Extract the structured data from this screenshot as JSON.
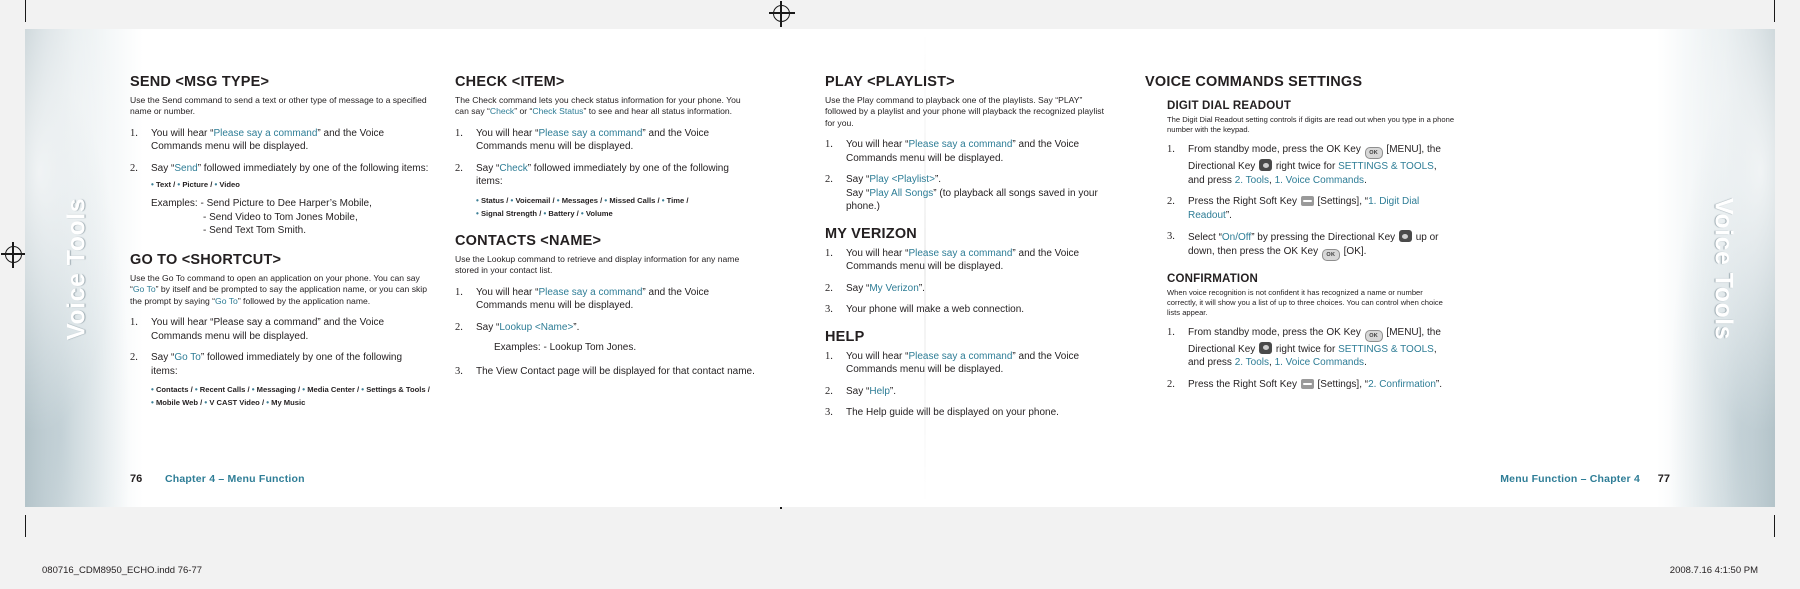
{
  "spread": {
    "left_page_number": "76",
    "right_page_number": "77",
    "left_running_head": "Chapter 4 – Menu Function",
    "right_running_head": "Menu Function – Chapter 4",
    "side_tab_label": "Voice Tools",
    "file_meta_left": "080716_CDM8950_ECHO.indd   76-77",
    "file_meta_right": "2008.7.16   4:1:50 PM"
  },
  "col1": {
    "s1": {
      "heading": "SEND <MSG TYPE>",
      "intro": "Use the Send command to send a text or other type of message to a specified name or number.",
      "step1_a": "You will hear “",
      "step1_hl": "Please say a command",
      "step1_b": "” and the Voice Commands menu will be displayed.",
      "step2_a": "Say “",
      "step2_hl": "Send",
      "step2_b": "” followed immediately by one of the following items:",
      "bullets": [
        "Text",
        "Picture",
        "Video"
      ],
      "examples_label": "Examples:",
      "examples": [
        "- Send Picture to Dee Harper’s Mobile,",
        "- Send Video to Tom Jones Mobile,",
        "- Send Text Tom Smith."
      ]
    },
    "s2": {
      "heading": "GO TO <SHORTCUT>",
      "intro_a": "Use the Go To command to open an application on your phone. You can say “",
      "intro_hl1": "Go To",
      "intro_b": "” by itself and be prompted to say the application name, or you can skip the prompt by saying “",
      "intro_hl2": "Go To",
      "intro_c": "” followed by the application name.",
      "step1": "You will hear “Please say a command” and the Voice Commands menu will be displayed.",
      "step2_a": "Say “",
      "step2_hl": "Go To",
      "step2_b": "” followed immediately by one of the following items:",
      "bullets_row1": [
        "Contacts",
        "Recent Calls",
        "Messaging",
        "Media Center",
        "Settings & Tools"
      ],
      "bullets_row2": [
        "Mobile Web",
        "V CAST Video",
        "My Music"
      ]
    }
  },
  "col2": {
    "s1": {
      "heading": "CHECK <ITEM>",
      "intro_a": "The Check command lets you check status information for your phone. You can say “",
      "intro_hl1": "Check",
      "intro_b": "” or “",
      "intro_hl2": "Check Status",
      "intro_c": "” to see and hear all status information.",
      "step1_a": "You will hear “",
      "step1_hl": "Please say a command",
      "step1_b": "” and the Voice Commands menu will be displayed.",
      "step2_a": "Say “",
      "step2_hl": "Check",
      "step2_b": "” followed immediately by one of the following items:",
      "bullets_row1": [
        "Status",
        "Voicemail",
        "Messages",
        "Missed Calls",
        "Time"
      ],
      "bullets_row2": [
        "Signal Strength",
        "Battery",
        "Volume"
      ]
    },
    "s2": {
      "heading": "CONTACTS <NAME>",
      "intro": "Use the Lookup command to retrieve and display information for any name stored in your contact list.",
      "step1_a": "You will hear “",
      "step1_hl": "Please say a command",
      "step1_b": "” and the Voice Commands menu will be displayed.",
      "step2_a": "Say “",
      "step2_hl": "Lookup <Name>",
      "step2_b": "”.",
      "example": "Examples: - Lookup Tom Jones.",
      "step3": "The View Contact page will be displayed for that contact name."
    }
  },
  "col3": {
    "s1": {
      "heading": "PLAY <PLAYLIST>",
      "intro": "Use the Play command to playback one of the playlists. Say “PLAY” followed by a playlist and your phone will playback the recognized playlist for you.",
      "step1_a": "You will hear “",
      "step1_hl": "Please say a command",
      "step1_b": "” and the Voice Commands menu will be displayed.",
      "step2_a": "Say “",
      "step2_hl": "Play <Playlist>",
      "step2_b": "”.",
      "step2_line2_a": "Say “",
      "step2_line2_hl": "Play All Songs",
      "step2_line2_b": "” (to playback all songs saved in your phone.)"
    },
    "s2": {
      "heading": "MY VERIZON",
      "step1_a": "You will hear “",
      "step1_hl": "Please say a command",
      "step1_b": "” and the Voice Commands menu will be displayed.",
      "step2_a": "Say “",
      "step2_hl": "My Verizon",
      "step2_b": "”.",
      "step3": "Your phone will make a web connection."
    },
    "s3": {
      "heading": "HELP",
      "step1_a": "You will hear “",
      "step1_hl": "Please say a command",
      "step1_b": "” and the Voice Commands menu will be displayed.",
      "step2_a": "Say “",
      "step2_hl": "Help",
      "step2_b": "”.",
      "step3": "The Help guide will be displayed on your phone."
    }
  },
  "col4": {
    "heading": "VOICE COMMANDS SETTINGS",
    "s1": {
      "heading": "DIGIT DIAL READOUT",
      "intro": "The Digit Dial Readout setting controls if digits are read out when you type in a phone number with the keypad.",
      "step1_a": "From standby mode, press the OK Key",
      "step1_b": "[MENU], the Directional Key",
      "step1_c": "right twice for",
      "step1_hl1": "SETTINGS & TOOLS",
      "step1_d": ", and press",
      "step1_hl2": "2. Tools",
      "step1_e": ",",
      "step1_hl3": "1. Voice Commands",
      "step1_f": ".",
      "step2_a": "Press the Right Soft Key",
      "step2_b": "[Settings], “",
      "step2_hl": "1. Digit Dial Readout",
      "step2_c": "”.",
      "step3_a": "Select “",
      "step3_hl": "On/Off",
      "step3_b": "” by pressing the Directional Key",
      "step3_c": "up or down, then press the OK Key",
      "step3_d": "[OK]."
    },
    "s2": {
      "heading": "CONFIRMATION",
      "intro": "When voice recognition is not confident it has recognized a name or number correctly, it will show you a list of up to three choices. You can control when choice lists appear.",
      "step1_a": "From standby mode, press the OK Key",
      "step1_b": "[MENU], the Directional Key",
      "step1_c": "right twice for",
      "step1_hl1": "SETTINGS & TOOLS",
      "step1_d": ", and press",
      "step1_hl2": "2. Tools",
      "step1_e": ",",
      "step1_hl3": "1. Voice Commands",
      "step1_f": ".",
      "step2_a": "Press the Right Soft Key",
      "step2_b": "[Settings], “",
      "step2_hl": "2. Confirmation",
      "step2_c": "”."
    }
  },
  "icons": {
    "ok_key": "OK",
    "nav_key": "nav-key-icon",
    "soft_key": "soft-key-icon"
  }
}
